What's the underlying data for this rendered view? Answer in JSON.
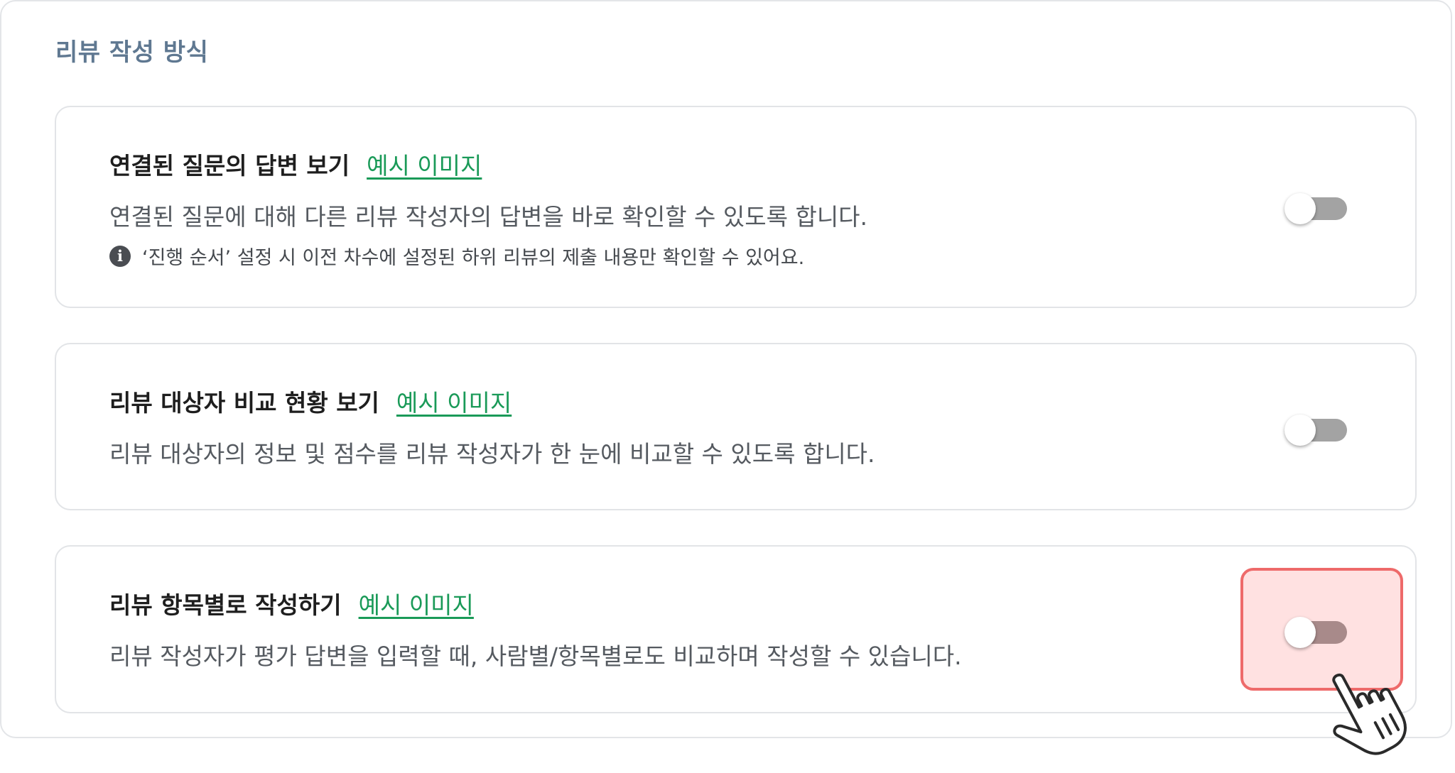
{
  "section": {
    "title": "리뷰 작성 방식"
  },
  "cards": [
    {
      "title": "연결된 질문의 답변 보기",
      "link": "예시 이미지",
      "description": "연결된 질문에 대해 다른 리뷰 작성자의 답변을 바로 확인할 수 있도록 합니다.",
      "note": "‘진행 순서’ 설정 시 이전 차수에 설정된 하위 리뷰의 제출 내용만 확인할 수 있어요.",
      "toggle_on": false
    },
    {
      "title": "리뷰 대상자 비교 현황 보기",
      "link": "예시 이미지",
      "description": "리뷰 대상자의 정보 및 점수를 리뷰 작성자가 한 눈에 비교할 수 있도록 합니다.",
      "toggle_on": false
    },
    {
      "title": "리뷰 항목별로 작성하기",
      "link": "예시 이미지",
      "description": "리뷰 작성자가 평가 답변을 입력할 때, 사람별/항목별로도 비교하며 작성할 수 있습니다.",
      "toggle_on": false,
      "highlighted": true
    }
  ],
  "icons": {
    "info": "info-icon",
    "cursor": "pointer-hand-icon"
  },
  "colors": {
    "section_title": "#5f7891",
    "link": "#1a9a58",
    "toggle_off_track": "#a3a3a3",
    "highlight_border": "#ee6a6a",
    "highlight_fill": "#ffd6d6"
  }
}
